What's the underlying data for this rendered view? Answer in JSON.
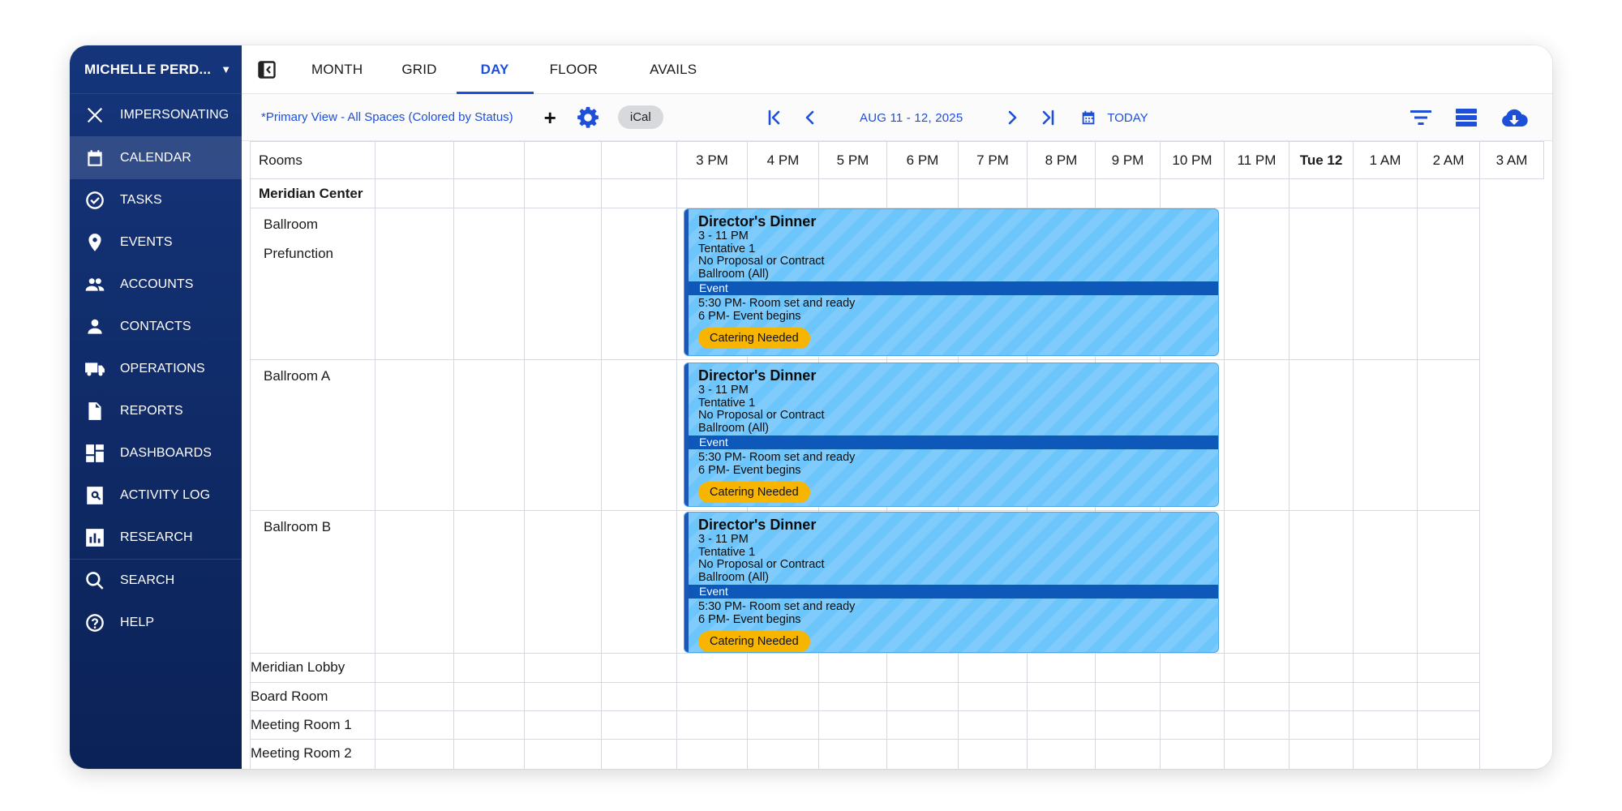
{
  "sidebar": {
    "user_name": "MICHELLE PERD...",
    "items": [
      {
        "label": "IMPERSONATING",
        "icon": "close-icon"
      },
      {
        "label": "CALENDAR",
        "icon": "calendar-icon"
      },
      {
        "label": "TASKS",
        "icon": "check-circle-icon"
      },
      {
        "label": "EVENTS",
        "icon": "location-pin-icon"
      },
      {
        "label": "ACCOUNTS",
        "icon": "group-icon"
      },
      {
        "label": "CONTACTS",
        "icon": "person-icon"
      },
      {
        "label": "OPERATIONS",
        "icon": "truck-icon"
      },
      {
        "label": "REPORTS",
        "icon": "document-icon"
      },
      {
        "label": "DASHBOARDS",
        "icon": "dashboard-icon"
      },
      {
        "label": "ACTIVITY LOG",
        "icon": "activity-log-icon"
      },
      {
        "label": "RESEARCH",
        "icon": "bar-chart-icon"
      },
      {
        "label": "SEARCH",
        "icon": "search-icon"
      },
      {
        "label": "HELP",
        "icon": "help-icon"
      }
    ],
    "active_item": "CALENDAR"
  },
  "tabs": [
    {
      "label": "MONTH"
    },
    {
      "label": "GRID"
    },
    {
      "label": "DAY"
    },
    {
      "label": "FLOOR"
    },
    {
      "label": "AVAILS"
    }
  ],
  "active_tab": "DAY",
  "toolbar": {
    "view_name": "*Primary View - All Spaces (Colored by Status)",
    "add_label": "+",
    "ical_label": "iCal",
    "date_range": "AUG 11 - 12, 2025",
    "today_label": "TODAY",
    "accent_color": "#1e4fd8"
  },
  "grid": {
    "rooms_header": "Rooms",
    "time_headers": [
      "",
      "",
      "",
      "",
      "3 PM",
      "4 PM",
      "5 PM",
      "6 PM",
      "7 PM",
      "8 PM",
      "9 PM",
      "10 PM",
      "11 PM",
      "Tue 12",
      "1 AM",
      "2 AM",
      "3 AM"
    ],
    "rooms": {
      "meridian_center": "Meridian Center",
      "ballroom": "Ballroom",
      "prefunction": "Prefunction",
      "ballroom_a": "Ballroom A",
      "ballroom_b": "Ballroom B",
      "meridian_lobby": "Meridian Lobby",
      "board_room": "Board Room",
      "meeting_room_1": "Meeting Room 1",
      "meeting_room_2": "Meeting Room 2"
    }
  },
  "events": [
    {
      "room": "Ballroom / Prefunction",
      "title": "Director's Dinner",
      "time": "3 - 11 PM",
      "status": "Tentative 1",
      "contract": "No Proposal or Contract",
      "space": "Ballroom (All)",
      "type": "Event",
      "note_1": "5:30 PM- Room set and ready",
      "note_2": "6 PM- Event begins",
      "badge": "Catering Needed"
    },
    {
      "room": "Ballroom A",
      "title": "Director's Dinner",
      "time": "3 - 11 PM",
      "status": "Tentative 1",
      "contract": "No Proposal or Contract",
      "space": "Ballroom (All)",
      "type": "Event",
      "note_1": "5:30 PM- Room set and ready",
      "note_2": "6 PM- Event begins",
      "badge": "Catering Needed"
    },
    {
      "room": "Ballroom B",
      "title": "Director's Dinner",
      "time": "3 - 11 PM",
      "status": "Tentative 1",
      "contract": "No Proposal or Contract",
      "space": "Ballroom (All)",
      "type": "Event",
      "note_1": "5:30 PM- Room set and ready",
      "note_2": "6 PM- Event begins",
      "badge": "Catering Needed"
    }
  ],
  "colors": {
    "sidebar": "#13306f",
    "event_fill": "#6cc5fb",
    "event_type_bar": "#0d58b9",
    "badge": "#f7b500"
  }
}
